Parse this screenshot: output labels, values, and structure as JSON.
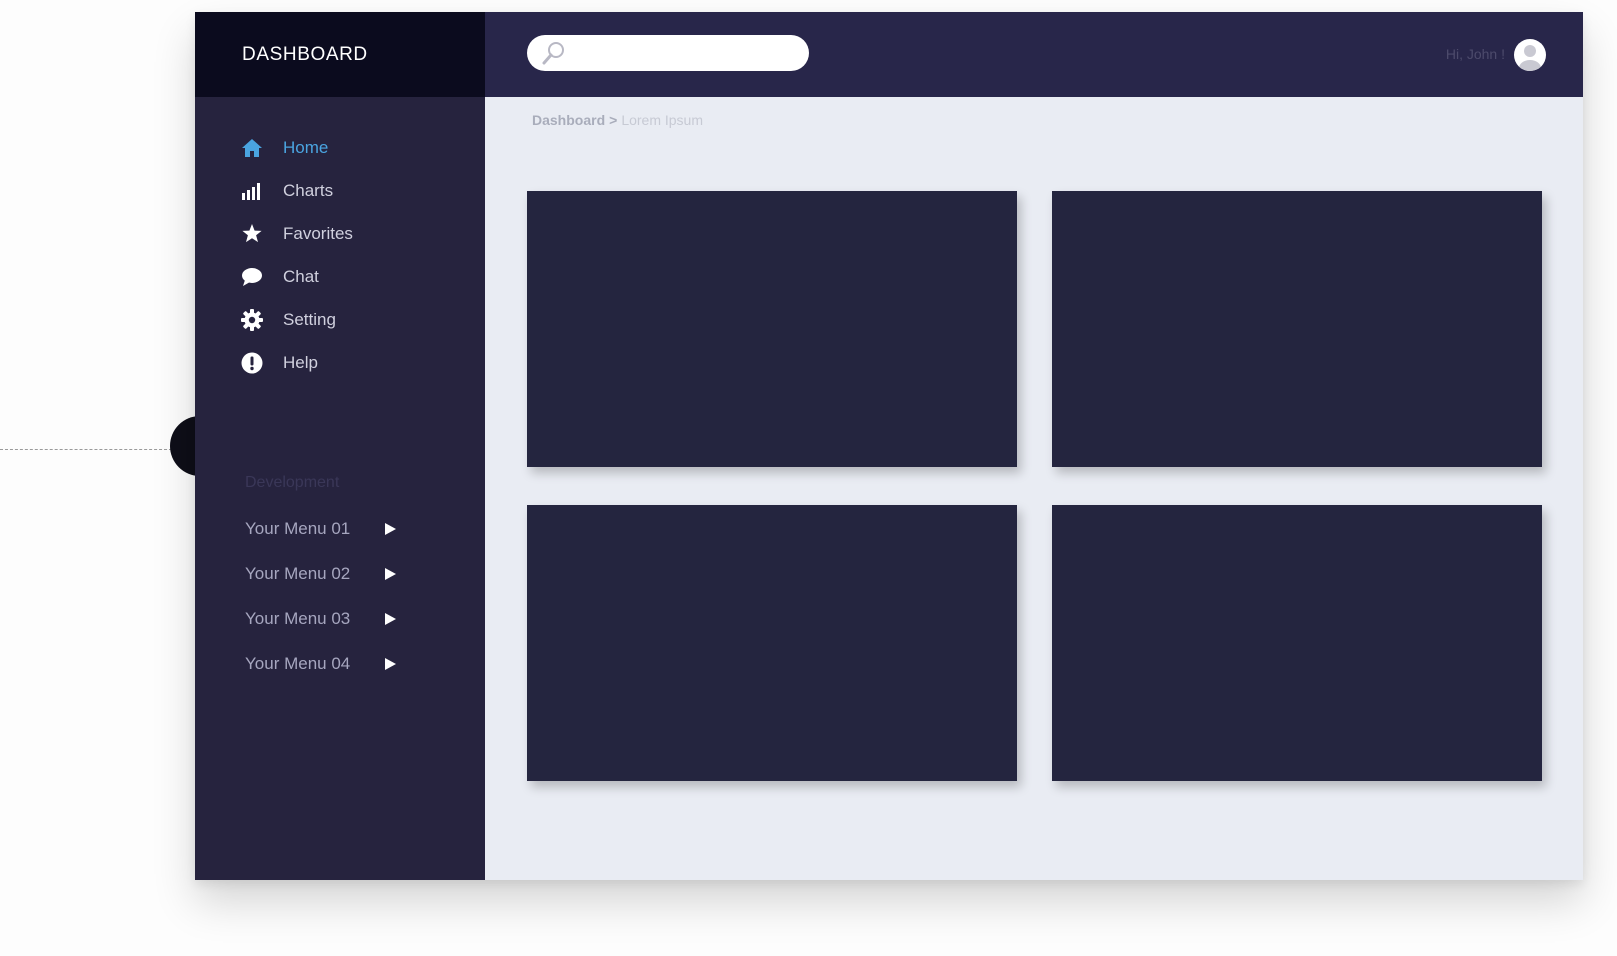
{
  "brand": {
    "title": "DASHBOARD"
  },
  "colors": {
    "sidebar": "#26233e",
    "brand_bar": "#0b0b1e",
    "topbar": "#28264a",
    "content": "#e9ecf3",
    "card": "#24253f",
    "active": "#4aa4e0"
  },
  "sidebar": {
    "items": [
      {
        "label": "Home",
        "icon": "home-icon",
        "active": true
      },
      {
        "label": "Charts",
        "icon": "bar-chart-icon",
        "active": false
      },
      {
        "label": "Favorites",
        "icon": "star-icon",
        "active": false
      },
      {
        "label": "Chat",
        "icon": "chat-bubble-icon",
        "active": false
      },
      {
        "label": "Setting",
        "icon": "gear-icon",
        "active": false
      },
      {
        "label": "Help",
        "icon": "exclamation-icon",
        "active": false
      }
    ],
    "section_title": "Development",
    "submenus": [
      {
        "label": "Your Menu 01",
        "icon": "play-arrow-icon"
      },
      {
        "label": "Your Menu 02",
        "icon": "play-arrow-icon"
      },
      {
        "label": "Your Menu 03",
        "icon": "play-arrow-icon"
      },
      {
        "label": "Your Menu 04",
        "icon": "play-arrow-icon"
      }
    ]
  },
  "header": {
    "search": {
      "value": "",
      "placeholder": "",
      "icon": "search-icon"
    },
    "greeting": "Hi, John !",
    "avatar_icon": "user-icon"
  },
  "breadcrumb": {
    "root": "Dashboard",
    "separator": ">",
    "current": "Lorem Ipsum"
  }
}
